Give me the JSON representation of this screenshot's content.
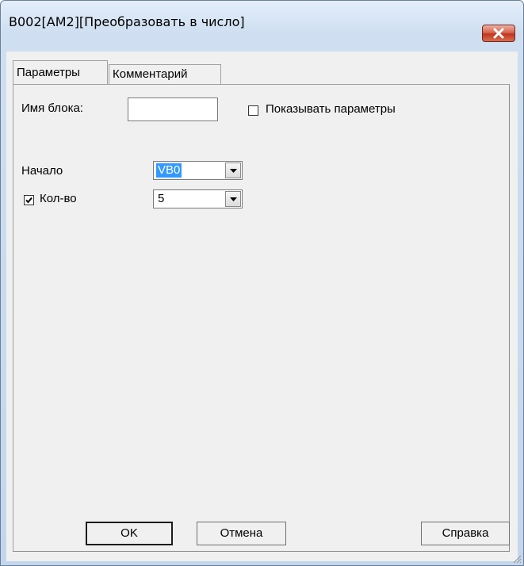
{
  "window": {
    "title": "B002[AM2][Преобразовать в число]",
    "close_icon": "close-icon",
    "accent": "#c2351f"
  },
  "tabs": [
    {
      "label": "Параметры",
      "active": true
    },
    {
      "label": "Комментарий",
      "active": false
    }
  ],
  "params": {
    "block_name_label": "Имя блока:",
    "block_name_value": "",
    "show_params_label": "Показывать параметры",
    "show_params_checked": false,
    "start_label": "Начало",
    "start_value": "VB0",
    "count_label": "Кол-во",
    "count_checked": true,
    "count_value": "5"
  },
  "buttons": {
    "ok": "OK",
    "cancel": "Отмена",
    "help": "Справка"
  }
}
